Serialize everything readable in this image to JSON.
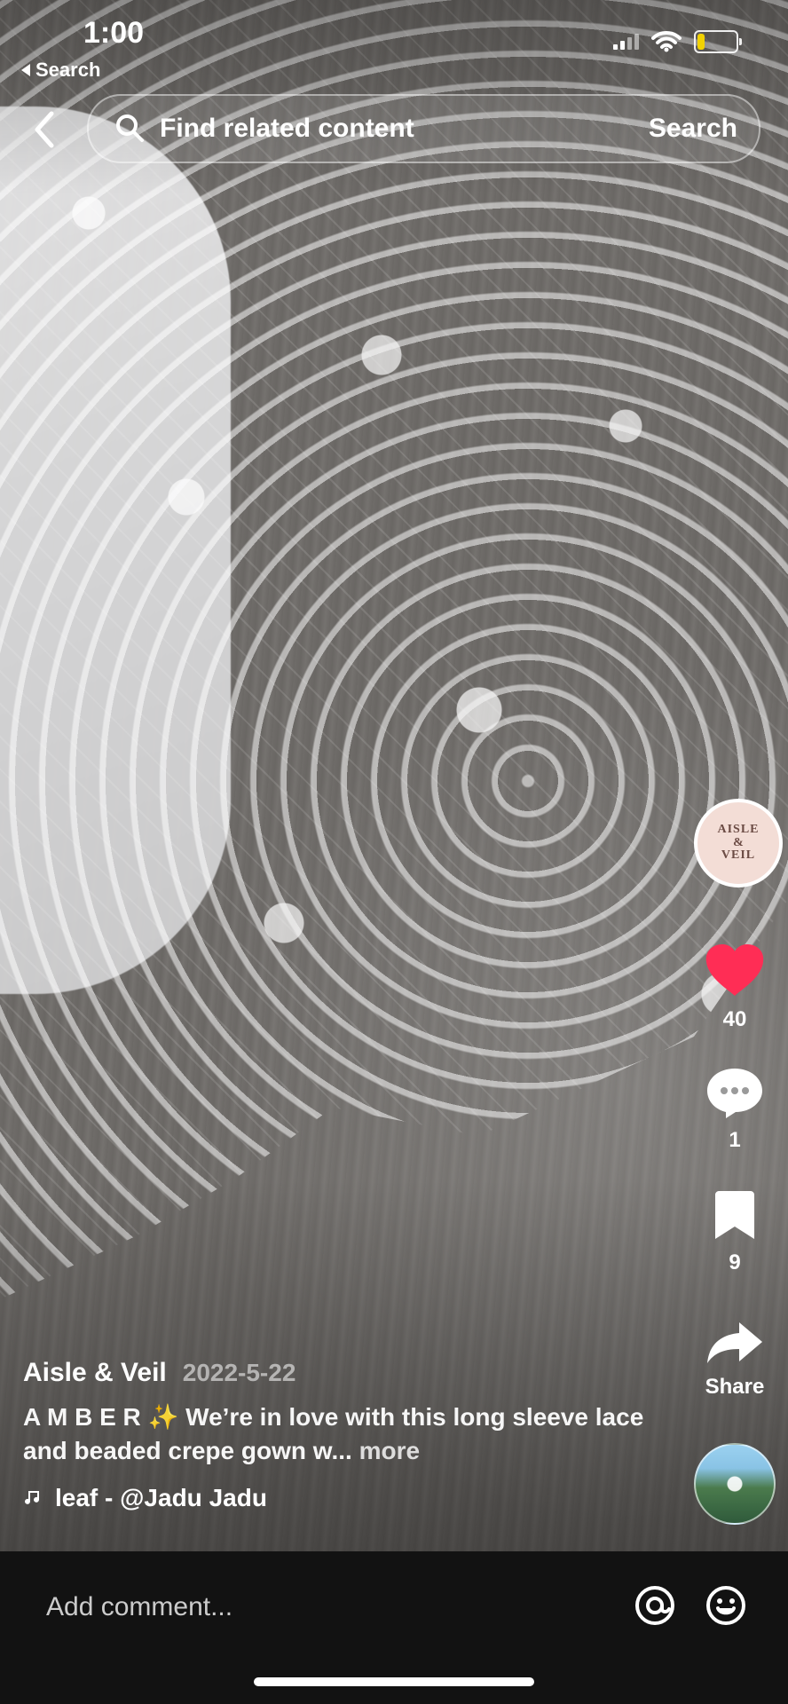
{
  "status_bar": {
    "time": "1:00",
    "back_app_label": "Search",
    "battery_level": 0.2,
    "battery_color": "#f2d200"
  },
  "top_search": {
    "placeholder": "Find related content",
    "button_label": "Search"
  },
  "rail": {
    "avatar_text": [
      "AISLE",
      "&",
      "VEIL"
    ],
    "like_count": "40",
    "comment_count": "1",
    "save_count": "9",
    "share_label": "Share",
    "like_color": "#ff2d55"
  },
  "caption": {
    "username": "Aisle & Veil",
    "date": "2022-5-22",
    "description_text": "A M B E R ✨ We’re in love with this long sleeve lace and beaded crepe gown w...",
    "more_label": "more",
    "music_text": "leaf - @Jadu Jadu"
  },
  "comment_bar": {
    "placeholder": "Add comment..."
  },
  "icons": {
    "back": "chevron-left-icon",
    "search": "search-icon",
    "like": "heart-icon",
    "comment": "speech-bubble-icon",
    "save": "bookmark-icon",
    "share": "share-arrow-icon",
    "music": "music-note-icon",
    "mention": "at-icon",
    "emoji": "emoji-icon"
  }
}
